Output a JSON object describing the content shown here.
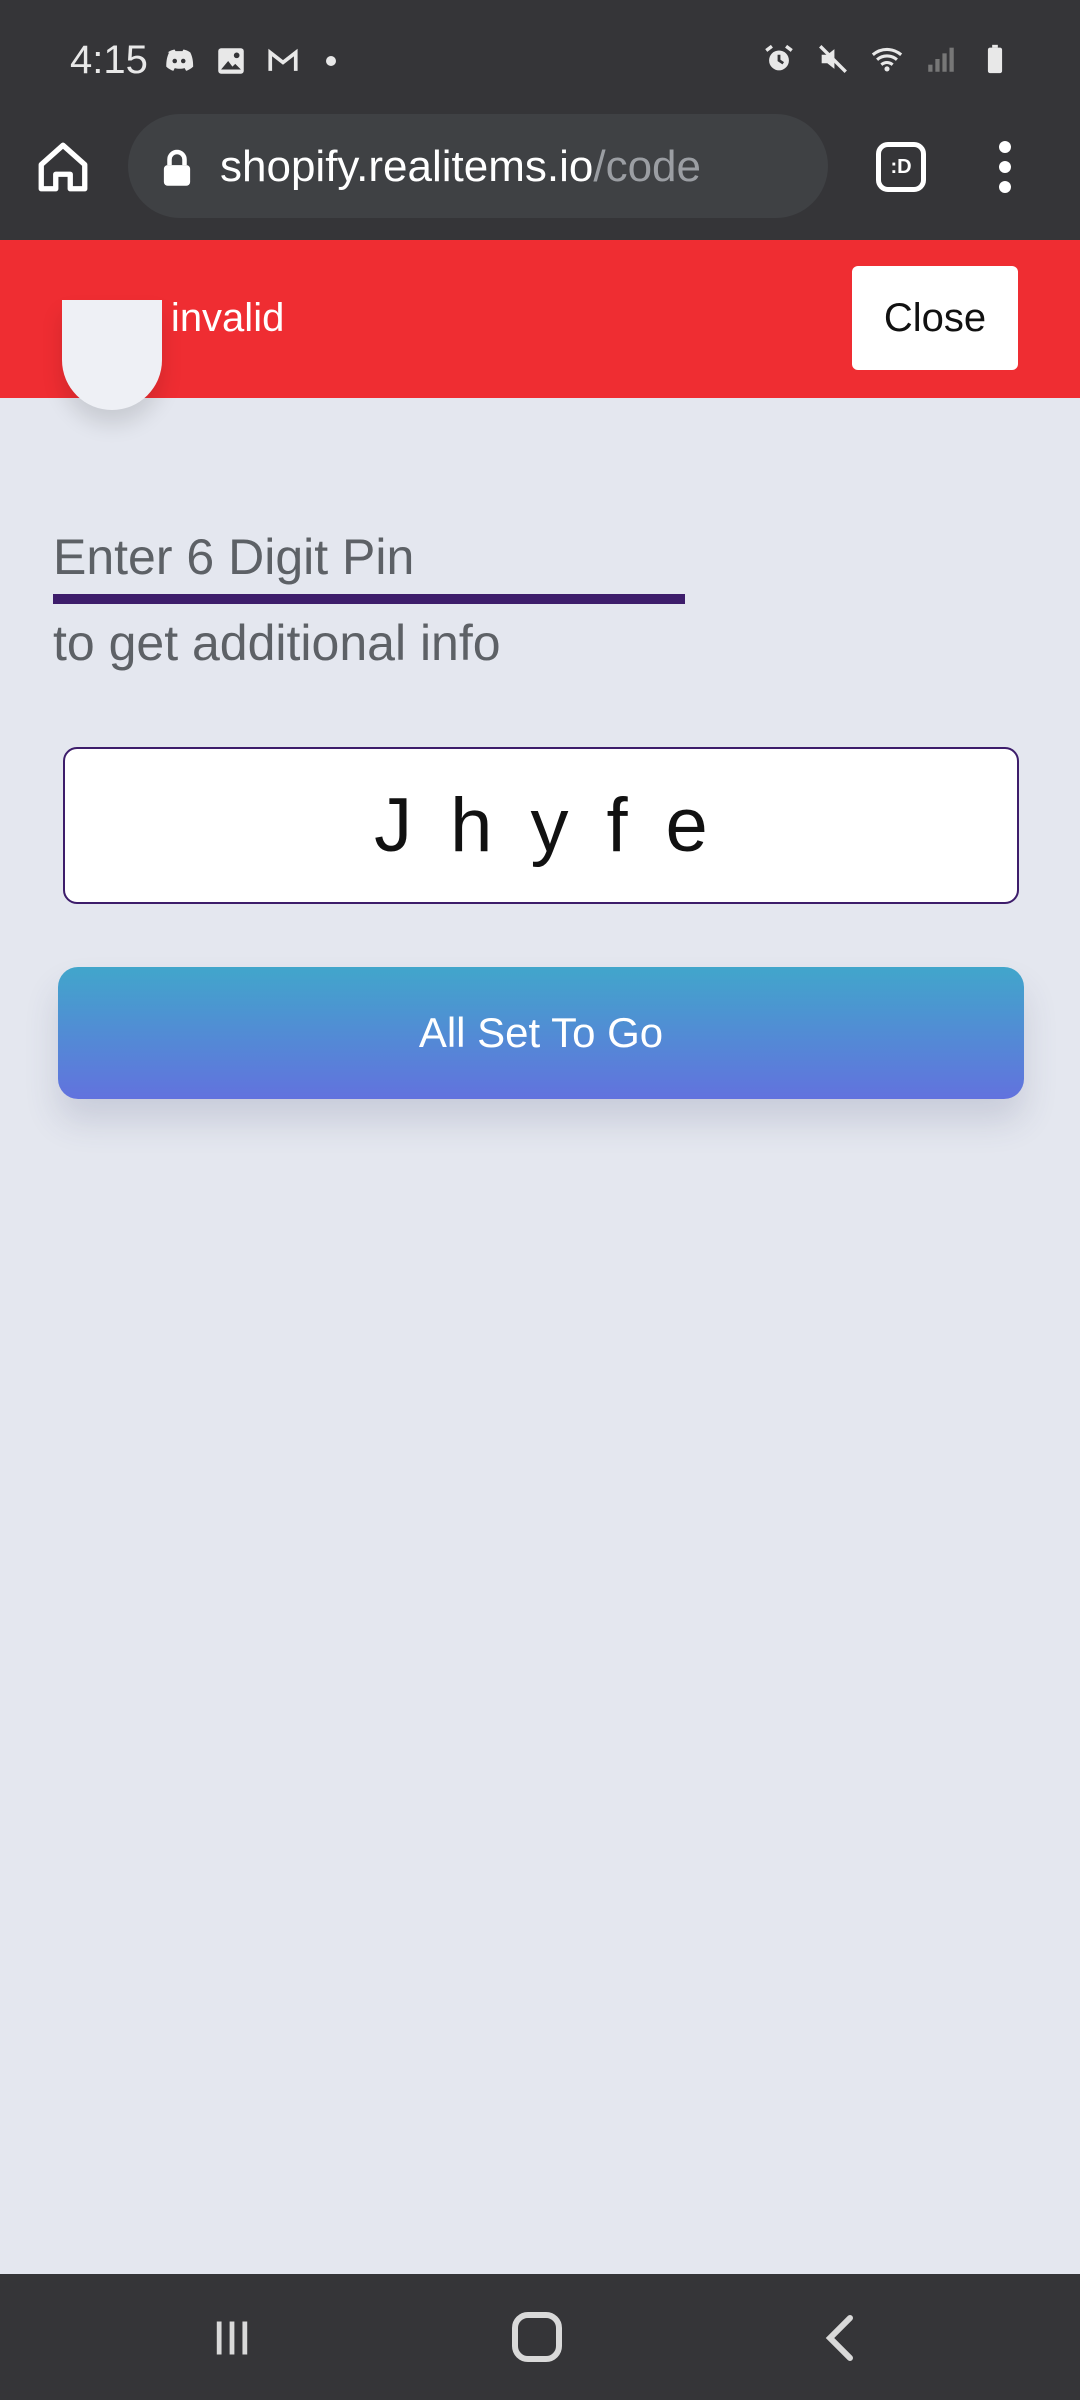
{
  "status_bar": {
    "time": "4:15",
    "left_icons": [
      "discord-icon",
      "gallery-icon",
      "gmail-icon"
    ],
    "right_icons": [
      "alarm-icon",
      "mute-icon",
      "wifi-icon",
      "signal-icon",
      "battery-icon"
    ]
  },
  "browser": {
    "url_host": "shopify.realitems.io",
    "url_path": "/code",
    "tabs_label": ":D"
  },
  "banner": {
    "message": "Pin is invalid",
    "close_label": "Close",
    "color": "#ef2d32"
  },
  "form": {
    "title": "Enter 6 Digit Pin",
    "subtitle": "to get additional info",
    "pin_value": "Jhyfe",
    "submit_label": "All Set To Go"
  },
  "colors": {
    "accent": "#3d1d6b",
    "button_gradient_top": "#41a6cb",
    "button_gradient_bottom": "#6272de",
    "background": "#e4e7ef"
  }
}
